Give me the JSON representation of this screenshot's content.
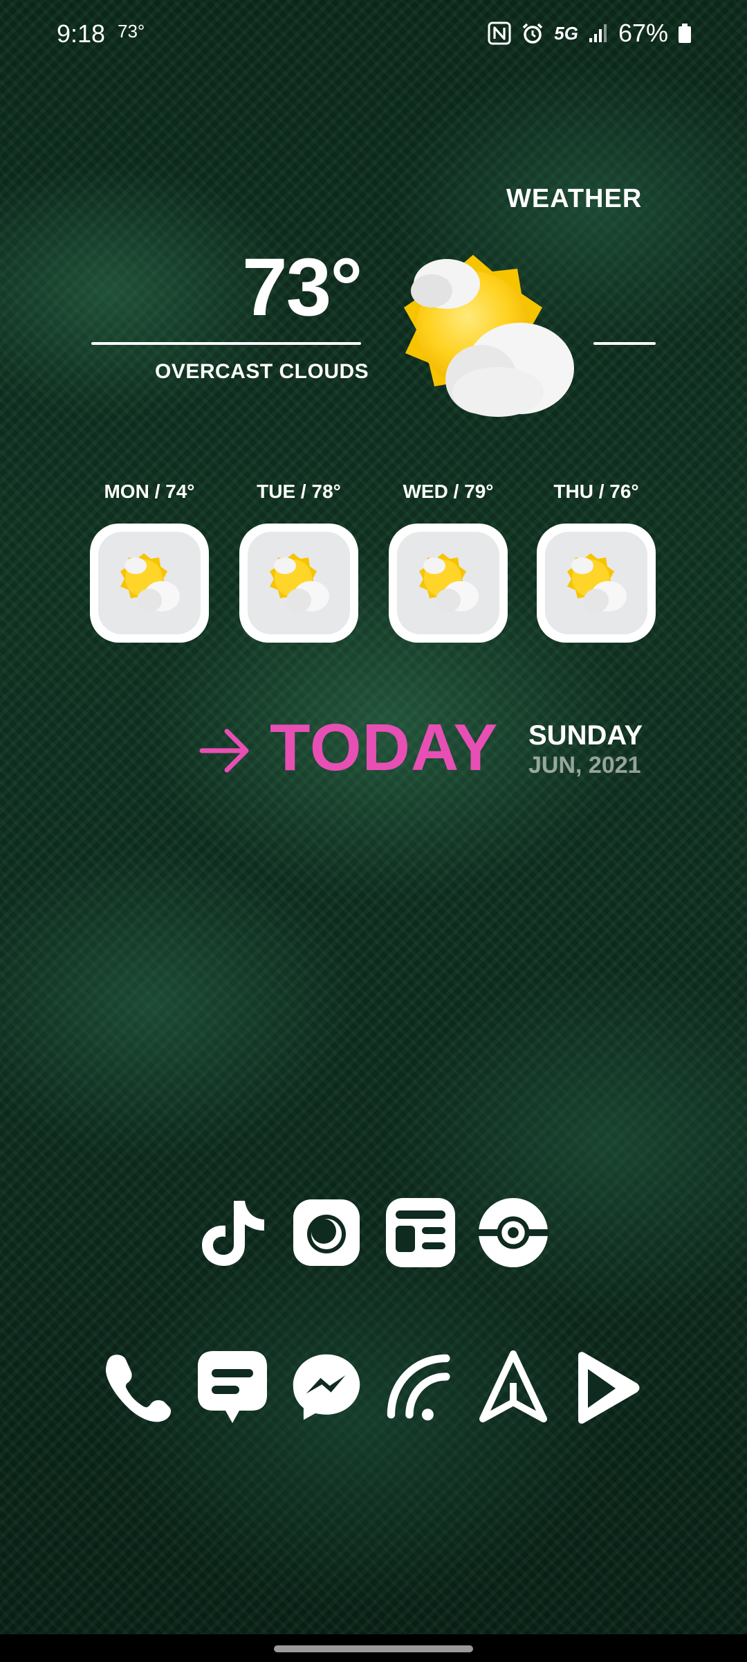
{
  "status_bar": {
    "time": "9:18",
    "temperature": "73°",
    "network": "5G",
    "battery": "67%",
    "icons": [
      "nfc-icon",
      "alarm-icon",
      "5g-icon",
      "signal-icon",
      "battery-icon"
    ]
  },
  "weather": {
    "title": "WEATHER",
    "current_temp": "73°",
    "condition": "OVERCAST CLOUDS",
    "icon": "partly-cloudy-icon",
    "forecast": [
      {
        "label": "MON / 74°",
        "icon": "partly-cloudy-icon"
      },
      {
        "label": "TUE / 78°",
        "icon": "partly-cloudy-icon"
      },
      {
        "label": "WED / 79°",
        "icon": "partly-cloudy-icon"
      },
      {
        "label": "THU / 76°",
        "icon": "partly-cloudy-icon"
      }
    ]
  },
  "today": {
    "label": "TODAY",
    "weekday": "SUNDAY",
    "date": "JUN, 2021",
    "accent_color": "#e84fb4"
  },
  "apps_row1": [
    "tiktok-icon",
    "camera-icon",
    "news-icon",
    "pokeball-icon"
  ],
  "apps_dock": [
    "phone-icon",
    "messages-icon",
    "messenger-icon",
    "arc-icon",
    "navigation-icon",
    "play-store-icon"
  ]
}
